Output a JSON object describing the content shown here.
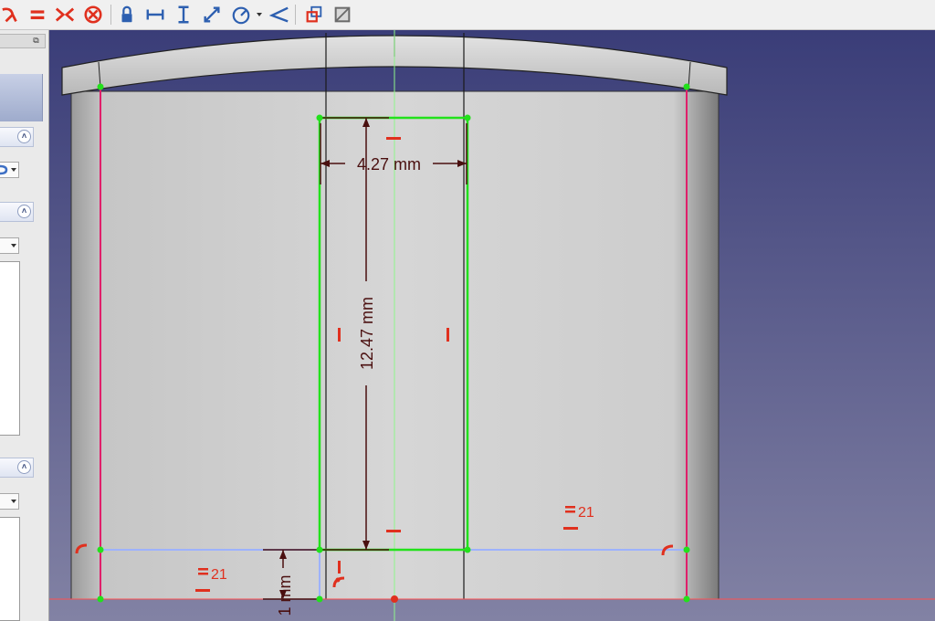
{
  "toolbar": {
    "buttons": [
      {
        "name": "constrain-tangent-icon",
        "color": "#e0301e"
      },
      {
        "name": "constrain-equal-icon",
        "color": "#e0301e"
      },
      {
        "name": "constrain-symmetric-icon",
        "color": "#e0301e"
      },
      {
        "name": "constrain-block-icon",
        "color": "#e0301e"
      },
      {
        "name": "constrain-lock-icon",
        "color": "#2d5fb0"
      },
      {
        "name": "constrain-horizontal-distance-icon",
        "color": "#2d5fb0"
      },
      {
        "name": "constrain-vertical-distance-icon",
        "color": "#2d5fb0"
      },
      {
        "name": "constrain-distance-icon",
        "color": "#2d5fb0"
      },
      {
        "name": "constrain-radius-icon",
        "color": "#2d5fb0"
      },
      {
        "name": "constrain-angle-icon",
        "color": "#2d5fb0"
      },
      {
        "name": "toggle-driving-constraint-icon",
        "color": "#e0301e"
      },
      {
        "name": "toggle-construction-icon",
        "color": "#6b6b6b"
      }
    ]
  },
  "left_panel": {
    "float_icon": "restore-icon"
  },
  "sketch": {
    "dimensions": {
      "width": "4.27 mm",
      "height": "12.47 mm",
      "offset": "1 mm"
    },
    "equal_constraint_labels": [
      "21",
      "21"
    ],
    "colors": {
      "background_top": "#3a3d78",
      "background_bottom": "#8282a4",
      "body": "#d4d4d4",
      "selected_edge": "#22e11b",
      "construction_edge": "#e01e6a",
      "constraint_symbol": "#e0301e",
      "dimension": "#4a0f0f",
      "horizontal_line": "#9db2ff",
      "axis": "#ff5050"
    }
  }
}
